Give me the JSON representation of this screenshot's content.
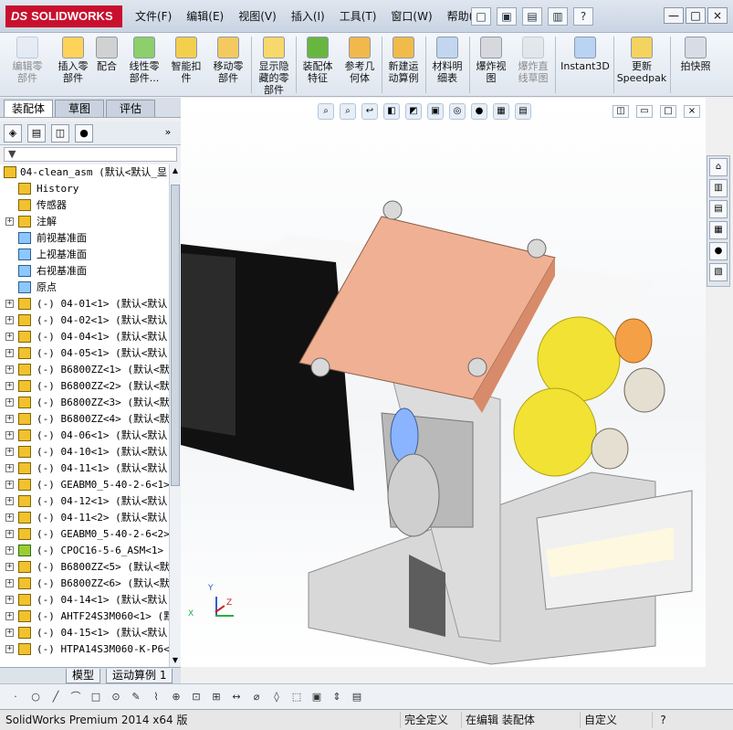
{
  "app": {
    "brand": "SOLIDWORKS",
    "brand_prefix": "DS"
  },
  "menu": [
    "文件(F)",
    "编辑(E)",
    "视图(V)",
    "插入(I)",
    "工具(T)",
    "窗口(W)",
    "帮助(H)"
  ],
  "quick_access": [
    "□",
    "▣",
    "▤",
    "▥",
    "?"
  ],
  "window_controls": {
    "minimize": "—",
    "restore": "□",
    "close": "×"
  },
  "ribbon": {
    "items": [
      {
        "label": "编辑零\n部件",
        "disabled": true
      },
      {
        "label": "插入零\n部件",
        "disabled": false
      },
      {
        "label": "配合",
        "disabled": false
      },
      {
        "label": "线性零\n部件...",
        "disabled": false
      },
      {
        "label": "智能扣\n件",
        "disabled": false
      },
      {
        "label": "移动零\n部件",
        "disabled": false
      },
      {
        "label": "显示隐\n藏的零\n部件",
        "disabled": false
      },
      {
        "label": "装配体\n特征",
        "disabled": false
      },
      {
        "label": "参考几\n何体",
        "disabled": false
      },
      {
        "label": "新建运\n动算例",
        "disabled": false
      },
      {
        "label": "材料明\n细表",
        "disabled": false
      },
      {
        "label": "爆炸视\n图",
        "disabled": false
      },
      {
        "label": "爆炸直\n线草图",
        "disabled": true
      },
      {
        "label": "Instant3D",
        "disabled": false
      },
      {
        "label": "更新\nSpeedpak",
        "disabled": false
      },
      {
        "label": "拍快照",
        "disabled": false
      }
    ]
  },
  "left_tabs": [
    "装配体",
    "草图",
    "评估"
  ],
  "feature_manager": {
    "toolbar_symbols": [
      "◈",
      "▤",
      "◫",
      "●"
    ],
    "collapse_symbol": "»",
    "filter_symbol": "▼",
    "items": [
      {
        "label": "04-clean_asm  (默认<默认_显",
        "type": "root"
      },
      {
        "label": "History",
        "type": "folder"
      },
      {
        "label": "传感器",
        "type": "folder"
      },
      {
        "label": "注解",
        "type": "folder",
        "expand": true
      },
      {
        "label": "前视基准面",
        "type": "plane"
      },
      {
        "label": "上视基准面",
        "type": "plane"
      },
      {
        "label": "右视基准面",
        "type": "plane"
      },
      {
        "label": "原点",
        "type": "origin"
      },
      {
        "label": "(-) 04-01<1> (默认<默认",
        "type": "part",
        "expand": true
      },
      {
        "label": "(-) 04-02<1> (默认<默认",
        "type": "part",
        "expand": true
      },
      {
        "label": "(-) 04-04<1> (默认<默认",
        "type": "part",
        "expand": true
      },
      {
        "label": "(-) 04-05<1> (默认<默认",
        "type": "part",
        "expand": true
      },
      {
        "label": "(-) B6800ZZ<1> (默认<默",
        "type": "part",
        "expand": true
      },
      {
        "label": "(-) B6800ZZ<2> (默认<默",
        "type": "part",
        "expand": true
      },
      {
        "label": "(-) B6800ZZ<3> (默认<默",
        "type": "part",
        "expand": true
      },
      {
        "label": "(-) B6800ZZ<4> (默认<默",
        "type": "part",
        "expand": true
      },
      {
        "label": "(-) 04-06<1> (默认<默认",
        "type": "part",
        "expand": true
      },
      {
        "label": "(-) 04-10<1> (默认<默认",
        "type": "part",
        "expand": true
      },
      {
        "label": "(-) 04-11<1> (默认<默认",
        "type": "part",
        "expand": true
      },
      {
        "label": "(-) GEABM0_5-40-2-6<1>",
        "type": "part",
        "expand": true
      },
      {
        "label": "(-) 04-12<1> (默认<默认",
        "type": "part",
        "expand": true
      },
      {
        "label": "(-) 04-11<2> (默认<默认",
        "type": "part",
        "expand": true
      },
      {
        "label": "(-) GEABM0_5-40-2-6<2>",
        "type": "part",
        "expand": true
      },
      {
        "label": "(-) CPOC16-5-6_ASM<1> (",
        "type": "subasm",
        "expand": true
      },
      {
        "label": "(-) B6800ZZ<5> (默认<默",
        "type": "part",
        "expand": true
      },
      {
        "label": "(-) B6800ZZ<6> (默认<默",
        "type": "part",
        "expand": true
      },
      {
        "label": "(-) 04-14<1> (默认<默认",
        "type": "part",
        "expand": true
      },
      {
        "label": "(-) AHTF24S3M060<1> (默",
        "type": "part",
        "expand": true
      },
      {
        "label": "(-) 04-15<1> (默认<默认",
        "type": "part",
        "expand": true
      },
      {
        "label": "(-) HTPA14S3M060-K-P6<1",
        "type": "part",
        "expand": true
      }
    ]
  },
  "view_toolbar": [
    "⌕",
    "⌕",
    "↩",
    "◧",
    "◩",
    "▣",
    "◎",
    "●",
    "▦",
    "▤"
  ],
  "viewport_controls": [
    "◫",
    "▭",
    "□",
    "×"
  ],
  "task_pane": [
    "⌂",
    "▥",
    "▤",
    "▦",
    "●",
    "▧"
  ],
  "triad": {
    "x": "X",
    "y": "Y",
    "z": "Z"
  },
  "bottom_tabs": [
    "模型",
    "运动算例 1"
  ],
  "sketch_toolbar": [
    "·",
    "○",
    "╱",
    "⌒",
    "□",
    "⊙",
    "✎",
    "⌇",
    "⊕",
    "⊡",
    "⊞",
    "↔",
    "⌀",
    "◊",
    "⬚",
    "▣",
    "⇕",
    "▤"
  ],
  "status": {
    "version": "SolidWorks Premium 2014 x64 版",
    "fully_defined": "完全定义",
    "editing": "在编辑 装配体",
    "custom": "自定义",
    "help": "?"
  }
}
